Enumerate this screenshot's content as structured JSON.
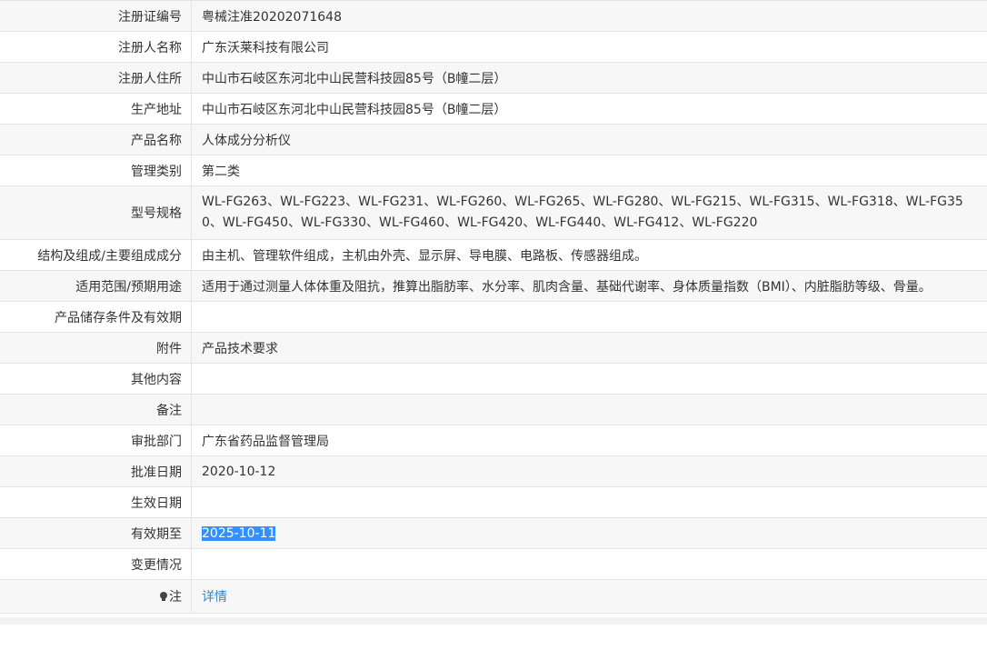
{
  "rows": [
    {
      "label": "注册证编号",
      "value": "粤械注准20202071648"
    },
    {
      "label": "注册人名称",
      "value": "广东沃莱科技有限公司"
    },
    {
      "label": "注册人住所",
      "value": "中山市石岐区东河北中山民营科技园85号（B幢二层）"
    },
    {
      "label": "生产地址",
      "value": "中山市石岐区东河北中山民营科技园85号（B幢二层）"
    },
    {
      "label": "产品名称",
      "value": "人体成分分析仪"
    },
    {
      "label": "管理类别",
      "value": "第二类"
    },
    {
      "label": "型号规格",
      "value": "WL-FG263、WL-FG223、WL-FG231、WL-FG260、WL-FG265、WL-FG280、WL-FG215、WL-FG315、WL-FG318、WL-FG350、WL-FG450、WL-FG330、WL-FG460、WL-FG420、WL-FG440、WL-FG412、WL-FG220"
    },
    {
      "label": "结构及组成/主要组成成分",
      "value": "由主机、管理软件组成，主机由外壳、显示屏、导电膜、电路板、传感器组成。"
    },
    {
      "label": "适用范围/预期用途",
      "value": "适用于通过测量人体体重及阻抗，推算出脂肪率、水分率、肌肉含量、基础代谢率、身体质量指数（BMI）、内脏脂肪等级、骨量。"
    },
    {
      "label": "产品储存条件及有效期",
      "value": ""
    },
    {
      "label": "附件",
      "value": "产品技术要求"
    },
    {
      "label": "其他内容",
      "value": ""
    },
    {
      "label": "备注",
      "value": ""
    },
    {
      "label": "审批部门",
      "value": "广东省药品监督管理局"
    },
    {
      "label": "批准日期",
      "value": "2020-10-12"
    },
    {
      "label": "生效日期",
      "value": ""
    },
    {
      "label": "有效期至",
      "value": "2025-10-11"
    },
    {
      "label": "变更情况",
      "value": ""
    }
  ],
  "note": {
    "label": "注",
    "link": "详情",
    "icon": "lightbulb-icon"
  },
  "colors": {
    "link": "#2f88c9",
    "selection": "#3390ff",
    "stripe": "#f7f7f7",
    "border": "#e4e4e4"
  }
}
